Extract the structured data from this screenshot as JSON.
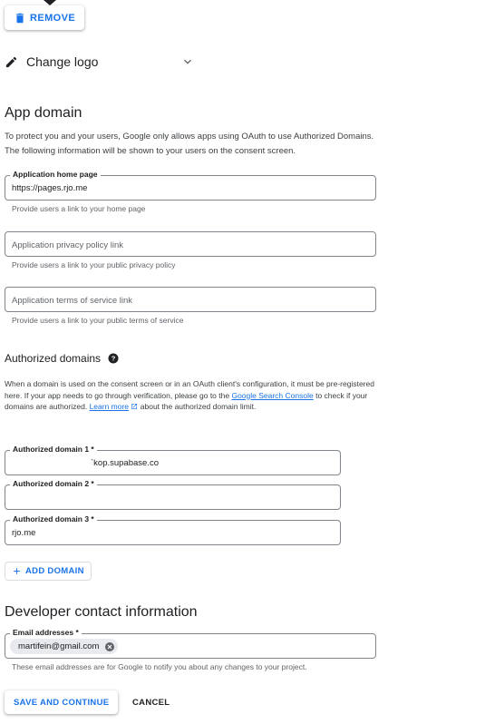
{
  "logo": {
    "remove_label": "REMOVE",
    "change_logo_label": "Change logo",
    "icons": {
      "remove": "trash-icon",
      "change": "pencil-icon",
      "expand": "chevron-down-icon"
    }
  },
  "app_domain": {
    "title": "App domain",
    "description": "To protect you and your users, Google only allows apps using OAuth to use Authorized Domains. The following information will be shown to your users on the consent screen.",
    "home_page": {
      "label": "Application home page",
      "value": "https://pages.rjo.me",
      "hint": "Provide users a link to your home page"
    },
    "privacy_policy": {
      "placeholder": "Application privacy policy link",
      "hint": "Provide users a link to your public privacy policy"
    },
    "terms_of_service": {
      "placeholder": "Application terms of service link",
      "hint": "Provide users a link to your public terms of service"
    }
  },
  "authorized_domains": {
    "title": "Authorized domains",
    "description_part1": "When a domain is used on the consent screen or in an OAuth client's configuration, it must be pre-registered here. If your app needs to go through verification, please go to the ",
    "console_link": "Google Search Console",
    "description_part2": " to check if your domains are authorized. ",
    "learn_more": "Learn more",
    "description_part3": " about the authorized domain limit.",
    "domains": [
      {
        "label": "Authorized domain 1 *",
        "value": "`kop.supabase.co"
      },
      {
        "label": "Authorized domain 2 *",
        "value": ""
      },
      {
        "label": "Authorized domain 3 *",
        "value": "rjo.me"
      }
    ],
    "add_label": "ADD DOMAIN"
  },
  "developer_contact": {
    "title": "Developer contact information",
    "email_label": "Email addresses *",
    "email_chip": "martifein@gmail.com",
    "hint": "These email addresses are for Google to notify you about any changes to your project."
  },
  "actions": {
    "save_label": "SAVE AND CONTINUE",
    "cancel_label": "CANCEL"
  },
  "colors": {
    "accent": "#1a73e8",
    "text": "#202124",
    "muted": "#5f6368",
    "border": "#80868b",
    "chip": "#e8eaed"
  }
}
